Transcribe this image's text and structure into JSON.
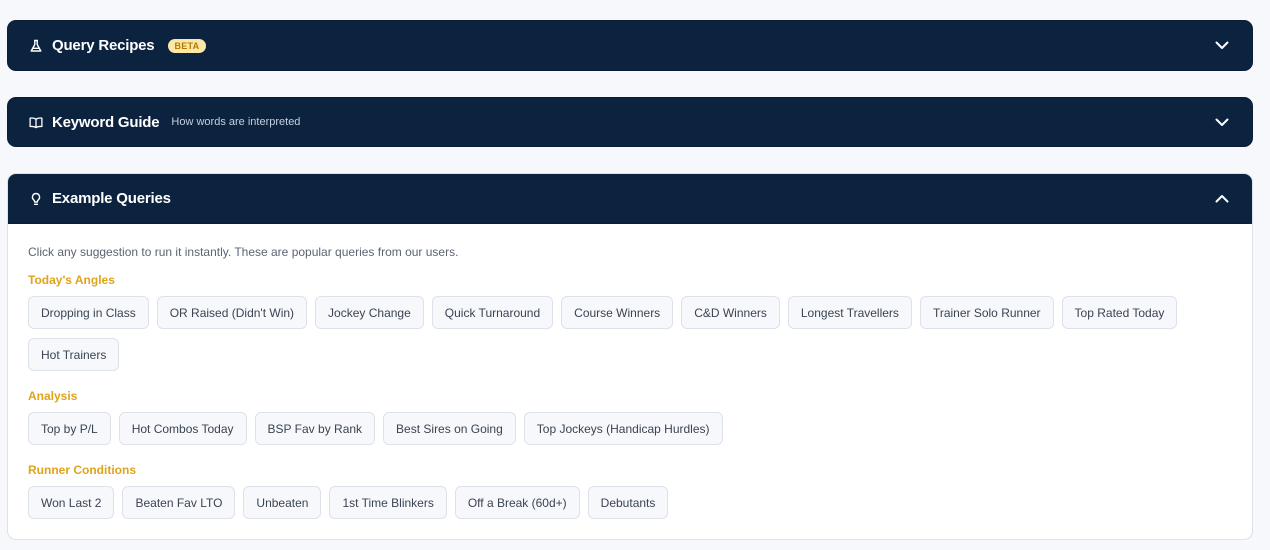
{
  "panels": {
    "recipes": {
      "title": "Query Recipes",
      "badge": "BETA",
      "icon": "flask-icon",
      "state": "collapsed"
    },
    "keywords": {
      "title": "Keyword Guide",
      "subtitle": "How words are interpreted",
      "icon": "book-icon",
      "state": "collapsed"
    },
    "examples": {
      "title": "Example Queries",
      "icon": "lightbulb-icon",
      "state": "expanded",
      "intro": "Click any suggestion to run it instantly. These are popular queries from our users.",
      "sections": [
        {
          "label": "Today's Angles",
          "chips": [
            "Dropping in Class",
            "OR Raised (Didn't Win)",
            "Jockey Change",
            "Quick Turnaround",
            "Course Winners",
            "C&D Winners",
            "Longest Travellers",
            "Trainer Solo Runner",
            "Top Rated Today",
            "Hot Trainers"
          ]
        },
        {
          "label": "Analysis",
          "chips": [
            "Top by P/L",
            "Hot Combos Today",
            "BSP Fav by Rank",
            "Best Sires on Going",
            "Top Jockeys (Handicap Hurdles)"
          ]
        },
        {
          "label": "Runner Conditions",
          "chips": [
            "Won Last 2",
            "Beaten Fav LTO",
            "Unbeaten",
            "1st Time Blinkers",
            "Off a Break (60d+)",
            "Debutants"
          ]
        }
      ]
    }
  },
  "colors": {
    "header_bg": "#0c2340",
    "accent": "#e0a31a",
    "page_bg": "#f6f8fb"
  }
}
